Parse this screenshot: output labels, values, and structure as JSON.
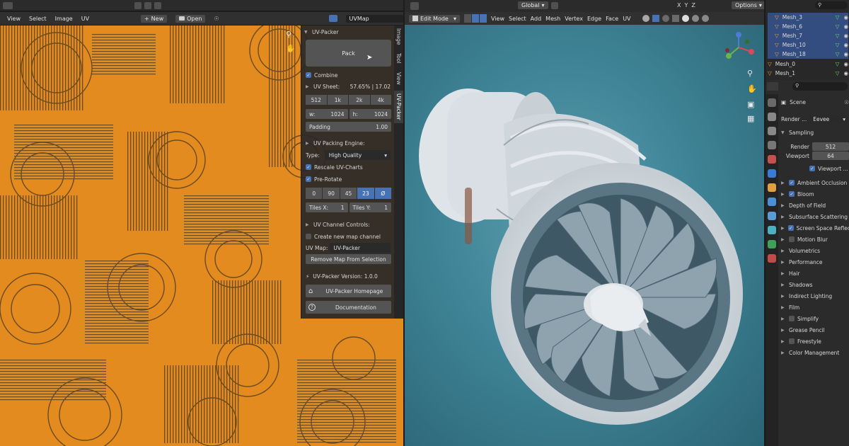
{
  "uv_editor": {
    "menus": [
      "View",
      "Select",
      "Image",
      "UV"
    ],
    "new_label": "New",
    "open_label": "Open",
    "uvmap_field": "UVMap"
  },
  "uv_packer": {
    "title": "UV-Packer",
    "pack_label": "Pack",
    "combine_label": "Combine",
    "uv_sheet_label": "UV Sheet:",
    "uv_sheet_value": "57.65% | 17.02",
    "resolutions": [
      "512",
      "1k",
      "2k",
      "4k"
    ],
    "w_label": "w:",
    "w_value": "1024",
    "h_label": "h:",
    "h_value": "1024",
    "padding_label": "Padding",
    "padding_value": "1.00",
    "engine_label": "UV Packing Engine:",
    "type_label": "Type:",
    "type_value": "High Quality",
    "rescale_label": "Rescale UV-Charts",
    "prerotate_label": "Pre-Rotate",
    "rotations": [
      "0",
      "90",
      "45",
      "23",
      "Ø"
    ],
    "tiles_x_label": "Tiles X:",
    "tiles_x_value": "1",
    "tiles_y_label": "Tiles Y:",
    "tiles_y_value": "1",
    "channel_label": "UV Channel Controls:",
    "new_map_label": "Create new map channel",
    "uv_map_label": "UV Map:",
    "uv_map_value": "UV-Packer",
    "remove_label": "Remove Map From Selection",
    "version_label": "UV-Packer Version: 1.0.0",
    "homepage_label": "UV-Packer Homepage",
    "docs_label": "Documentation",
    "tabs": [
      "Image",
      "Tool",
      "View",
      "UV-Packer"
    ]
  },
  "viewport": {
    "mode": "Edit Mode",
    "menus": [
      "View",
      "Select",
      "Add",
      "Mesh",
      "Vertex",
      "Edge",
      "Face",
      "UV"
    ],
    "orientation": "Global",
    "axes": [
      "X",
      "Y",
      "Z"
    ],
    "options_label": "Options"
  },
  "outliner": {
    "items": [
      {
        "name": "Mesh_3",
        "selected": true
      },
      {
        "name": "Mesh_6",
        "selected": true
      },
      {
        "name": "Mesh_7",
        "selected": true
      },
      {
        "name": "Mesh_10",
        "selected": true
      },
      {
        "name": "Mesh_18",
        "selected": true
      },
      {
        "name": "Mesh_0",
        "selected": false
      },
      {
        "name": "Mesh_1",
        "selected": false
      }
    ]
  },
  "properties": {
    "scene_label": "Scene",
    "render_label": "Render ...",
    "render_engine": "Eevee",
    "sampling_label": "Sampling",
    "render_samples_label": "Render",
    "render_samples": "512",
    "viewport_samples_label": "Viewport",
    "viewport_samples": "64",
    "viewport_denoise_label": "Viewport ...",
    "sections": [
      {
        "label": "Ambient Occlusion",
        "checkbox": true
      },
      {
        "label": "Bloom",
        "checkbox": true
      },
      {
        "label": "Depth of Field",
        "checkbox": null
      },
      {
        "label": "Subsurface Scattering",
        "checkbox": null
      },
      {
        "label": "Screen Space Reflect...",
        "checkbox": true
      },
      {
        "label": "Motion Blur",
        "checkbox": false
      },
      {
        "label": "Volumetrics",
        "checkbox": null
      },
      {
        "label": "Performance",
        "checkbox": null
      },
      {
        "label": "Hair",
        "checkbox": null
      },
      {
        "label": "Shadows",
        "checkbox": null
      },
      {
        "label": "Indirect Lighting",
        "checkbox": null
      },
      {
        "label": "Film",
        "checkbox": null
      },
      {
        "label": "Simplify",
        "checkbox": false
      },
      {
        "label": "Grease Pencil",
        "checkbox": null
      },
      {
        "label": "Freestyle",
        "checkbox": false
      },
      {
        "label": "Color Management",
        "checkbox": null
      }
    ]
  },
  "colors": {
    "accent": "#4772b3",
    "uv_islands": "#e38b1e",
    "viewport_bg": "#3f8597"
  }
}
